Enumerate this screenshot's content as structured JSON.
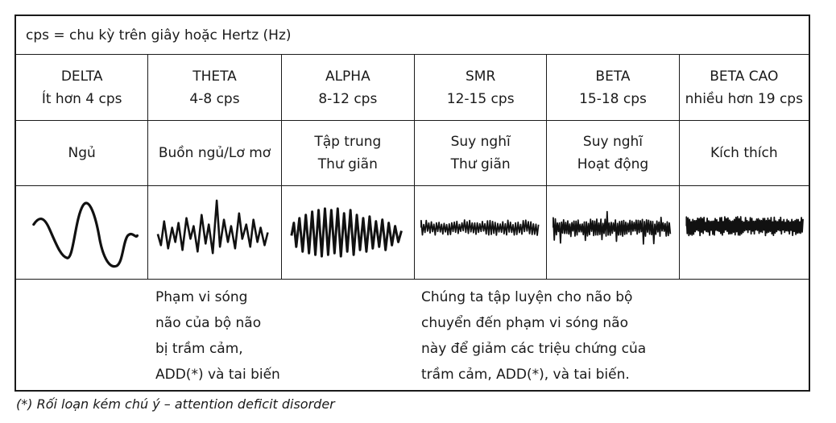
{
  "header": "cps = chu kỳ trên giây hoặc Hertz (Hz)",
  "bands": [
    {
      "name": "DELTA",
      "range": "Ít hơn 4 cps",
      "state": [
        "Ngủ"
      ]
    },
    {
      "name": "THETA",
      "range": "4-8 cps",
      "state": [
        "Buồn ngủ/Lơ mơ"
      ]
    },
    {
      "name": "ALPHA",
      "range": "8-12 cps",
      "state": [
        "Tập trung",
        "Thư giãn"
      ]
    },
    {
      "name": "SMR",
      "range": "12-15 cps",
      "state": [
        "Suy nghĩ",
        "Thư giãn"
      ]
    },
    {
      "name": "BETA",
      "range": "15-18 cps",
      "state": [
        "Suy nghĩ",
        "Hoạt động"
      ]
    },
    {
      "name": "BETA CAO",
      "range": "nhiều hơn 19 cps",
      "state": [
        "Kích thích"
      ]
    }
  ],
  "notes": {
    "left": [
      "Phạm vi sóng",
      "não của bộ não",
      "bị trầm cảm,",
      "ADD(*) và tai biến"
    ],
    "right": [
      "Chúng ta tập luyện cho não bộ",
      "chuyển đến phạm vi sóng não",
      "này để giảm các triệu chứng của",
      "trầm cảm, ADD(*), và tai biến."
    ]
  },
  "footnote": "(*) Rối loạn kém chú ý – attention deficit disorder"
}
